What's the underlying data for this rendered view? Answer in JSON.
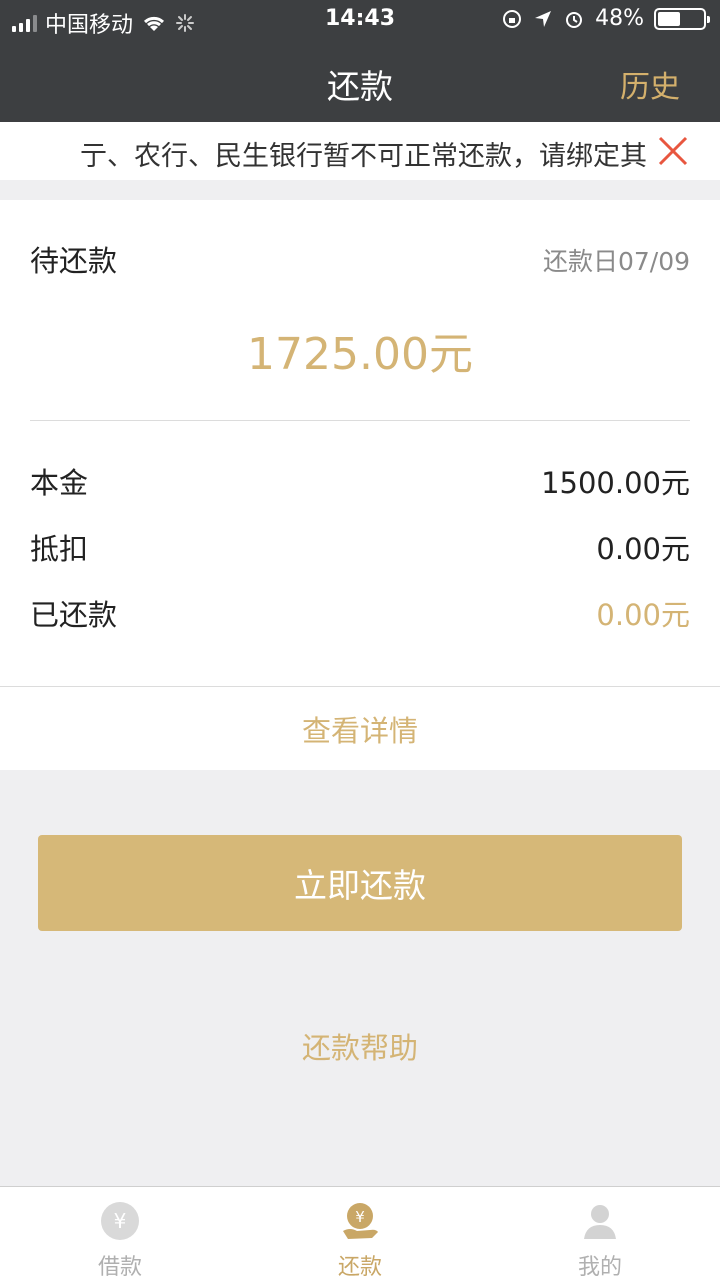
{
  "status_bar": {
    "carrier": "中国移动",
    "time": "14:43",
    "battery": "48%"
  },
  "nav": {
    "title": "还款",
    "history": "历史"
  },
  "notice": {
    "text": "亍、农行、民生银行暂不可正常还款，请绑定其"
  },
  "summary": {
    "pending_label": "待还款",
    "due_date": "还款日07/09",
    "amount": "1725.00元",
    "rows": [
      {
        "label": "本金",
        "value": "1500.00元"
      },
      {
        "label": "抵扣",
        "value": "0.00元"
      },
      {
        "label": "已还款",
        "value": "0.00元"
      }
    ],
    "detail_link": "查看详情"
  },
  "actions": {
    "repay_now": "立即还款",
    "repay_help": "还款帮助"
  },
  "tabs": [
    {
      "label": "借款",
      "icon": "yen-coin-icon"
    },
    {
      "label": "还款",
      "icon": "hand-coin-icon"
    },
    {
      "label": "我的",
      "icon": "person-icon"
    }
  ],
  "colors": {
    "header_bg": "#3d3f41",
    "accent_gold": "#d4b475",
    "button_gold": "#d6b878",
    "page_bg": "#efeff1",
    "close_red": "#e8563f"
  }
}
